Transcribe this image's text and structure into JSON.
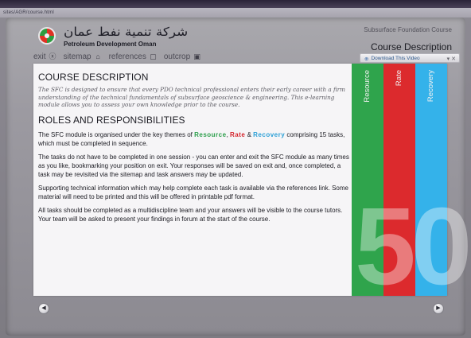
{
  "browser": {
    "url": "sites/AGR/course.html"
  },
  "header": {
    "logo_arabic": "شركة تنمية نفط عمان",
    "logo_english": "Petroleum Development Oman",
    "course_name": "Subsurface Foundation Course",
    "section_title": "Course Description",
    "download_label": "Download This Video",
    "download_controls": "▾ ✕"
  },
  "nav": {
    "exit_label": "exit",
    "exit_icon": "ⓧ",
    "sitemap_label": "sitemap",
    "sitemap_icon": "⌂",
    "references_label": "references",
    "references_icon": "▢",
    "outcrop_label": "outcrop",
    "outcrop_icon": "▣"
  },
  "content": {
    "course_heading": "COURSE DESCRIPTION",
    "intro": "The SFC is designed to ensure that every PDO technical professional enters their early career with a firm understanding of the technical fundamentals of subsurface geoscience & engineering. This e-learning module allows you to assess your own knowledge prior to the course.",
    "roles_heading": "ROLES AND RESPONSIBILITIES",
    "p1_before": "The SFC module is organised under the key themes of ",
    "p1_resource": "Resource",
    "p1_sep1": ", ",
    "p1_rate": "Rate",
    "p1_sep2": " & ",
    "p1_recovery": "Recovery",
    "p1_after": " comprising 15 tasks, which must be completed in sequence.",
    "p2": "The tasks do not have to be completed in one session - you can enter and exit the SFC module as many times as you like, bookmarking your position on exit. Your responses will be saved on exit and, once completed, a task may be revisited via the sitemap and task answers may be updated.",
    "p3": "Supporting technical information which may help complete each task is available via the references link. Some material will need to be printed and this will be offered in printable pdf format.",
    "p4": "All tasks should be completed as a multidiscipline team and your answers will be visible to the course tutors. Your team will be asked to present your findings in forum at the start of the course."
  },
  "themes": {
    "resource": "Resource",
    "rate": "Rate",
    "recovery": "Recovery",
    "big_number": "50",
    "colors": {
      "resource": "#2fa44c",
      "rate": "#dc2a2d",
      "recovery": "#34b2ea"
    }
  },
  "footer": {
    "prev_icon": "◀",
    "next_icon": "▶"
  }
}
